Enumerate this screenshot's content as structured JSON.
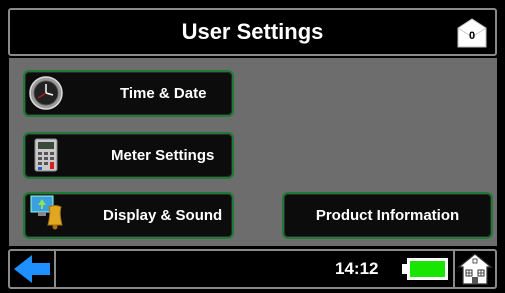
{
  "header": {
    "title": "User Settings",
    "message_count": "0"
  },
  "buttons": {
    "time_date": "Time & Date",
    "meter_settings": "Meter Settings",
    "display_sound": "Display & Sound",
    "product_information": "Product Information"
  },
  "footer": {
    "time": "14:12",
    "battery_level": 1.0
  },
  "colors": {
    "panel_bg": "#6d6d6d",
    "button_border": "#1f7a35",
    "battery_fill": "#19e600",
    "back_arrow": "#1e90ff"
  },
  "icons": [
    "clock-icon",
    "meter-icon",
    "display-sound-icon",
    "envelope-icon",
    "back-arrow-icon",
    "battery-icon",
    "home-icon"
  ]
}
